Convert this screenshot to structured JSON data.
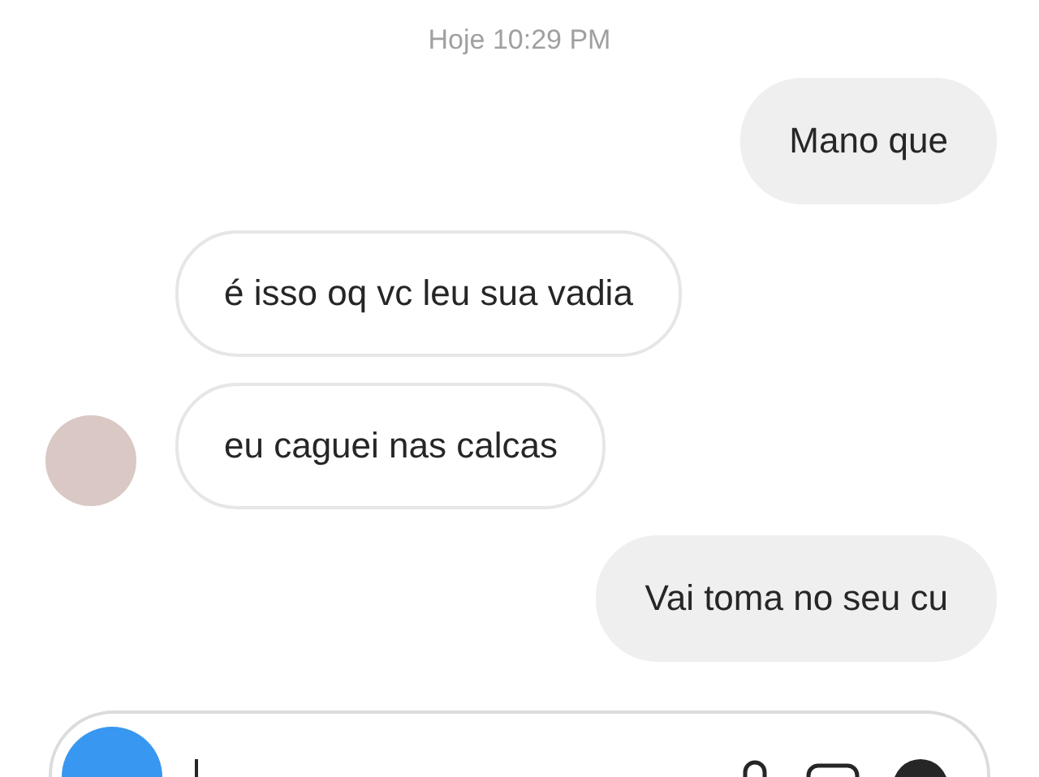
{
  "timestamp": "Hoje 10:29 PM",
  "messages": [
    {
      "kind": "sent",
      "text": "Mano que",
      "avatar": false
    },
    {
      "kind": "received",
      "text": "é isso oq vc leu sua vadia",
      "avatar": false
    },
    {
      "kind": "received",
      "text": "eu caguei nas calcas",
      "avatar": true
    },
    {
      "kind": "sent",
      "text": "Vai toma no seu cu",
      "avatar": false
    }
  ]
}
